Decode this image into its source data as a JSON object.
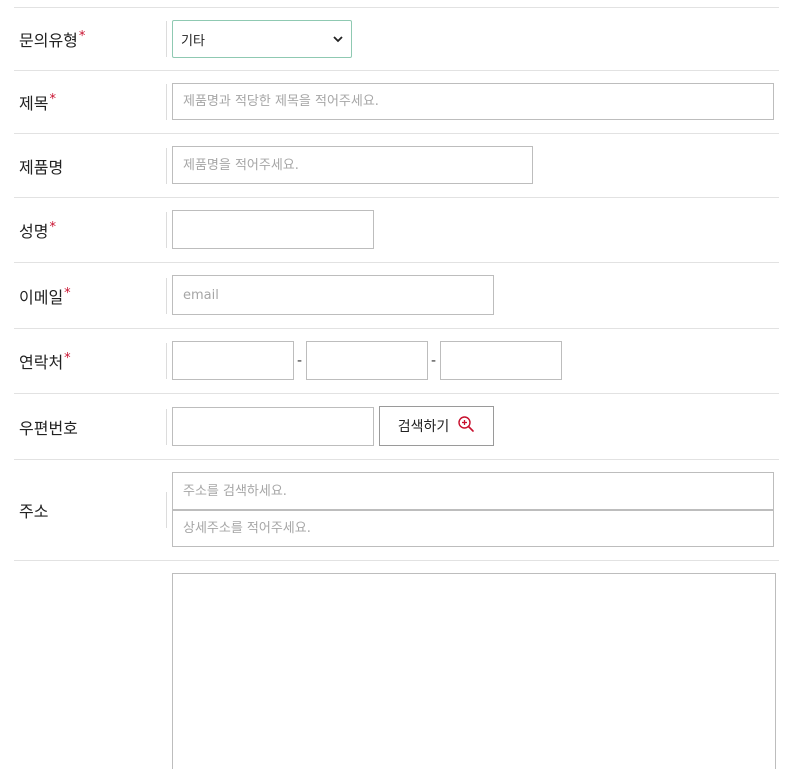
{
  "form": {
    "inquiry_type": {
      "label": "문의유형",
      "required_mark": "*",
      "selected": "기타"
    },
    "title": {
      "label": "제목",
      "required_mark": "*",
      "placeholder": "제품명과 적당한 제목을 적어주세요."
    },
    "product_name": {
      "label": "제품명",
      "placeholder": "제품명을 적어주세요."
    },
    "name": {
      "label": "성명",
      "required_mark": "*",
      "value": ""
    },
    "email": {
      "label": "이메일",
      "required_mark": "*",
      "placeholder": "email"
    },
    "phone": {
      "label": "연락처",
      "required_mark": "*",
      "separator": "-"
    },
    "postal_code": {
      "label": "우편번호",
      "search_button_label": "검색하기",
      "search_icon": "zoom-in-icon"
    },
    "address": {
      "label": "주소",
      "placeholder": "주소를 검색하세요.",
      "detail_placeholder": "상세주소를 적어주세요."
    },
    "accent_color": "#c8102e",
    "select_border_color": "#8fc9b2"
  }
}
